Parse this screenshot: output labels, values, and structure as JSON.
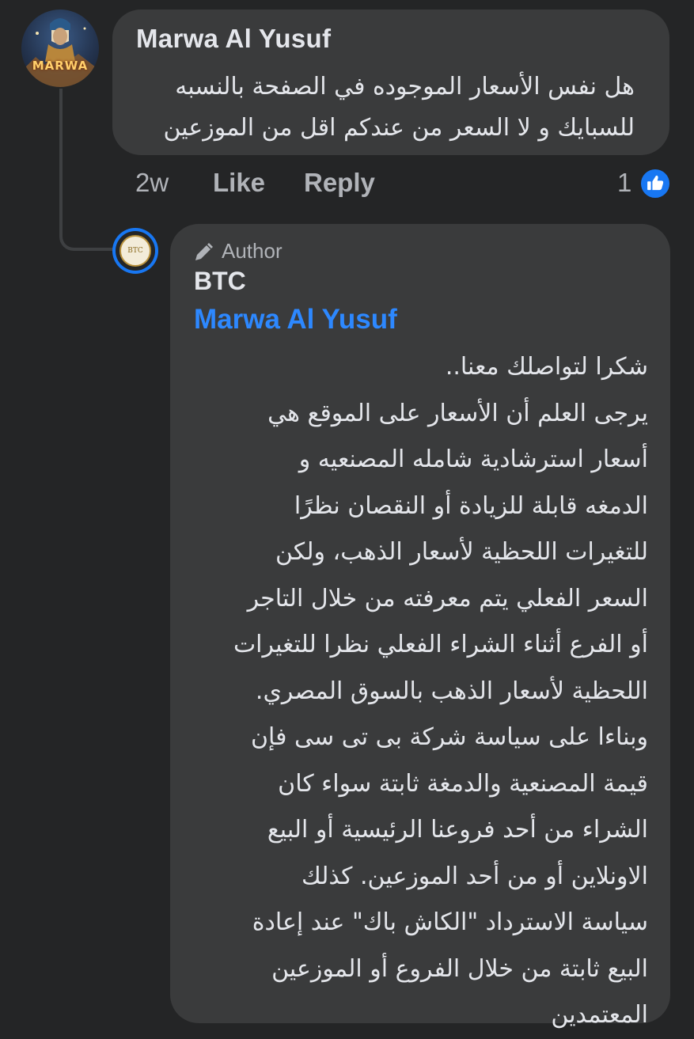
{
  "comment": {
    "author_name": "Marwa Al Yusuf",
    "avatar_text": "MARWA",
    "text_lines": [
      "هل نفس الأسعار الموجوده في الصفحة بالنسبه",
      "للسبايك و لا السعر من عندكم اقل من الموزعين"
    ],
    "time": "2w",
    "like_label": "Like",
    "reply_label": "Reply",
    "reaction_count": "1",
    "reaction_icon": "like-thumb-icon"
  },
  "reply": {
    "badge_label": "Author",
    "author_name": "BTC",
    "avatar_text": "BTC",
    "mention": "Marwa Al Yusuf",
    "text_lines": [
      "شكرا لتواصلك معنا..",
      "يرجى العلم أن الأسعار على الموقع هي",
      "أسعار استرشادية شامله المصنعيه و",
      "الدمغه قابلة للزيادة أو النقصان نظرًا",
      "للتغيرات اللحظية لأسعار الذهب، ولكن",
      "السعر الفعلي يتم معرفته من خلال التاجر",
      "أو الفرع أثناء الشراء الفعلي نظرا للتغيرات",
      "اللحظية لأسعار الذهب بالسوق المصري.",
      "وبناءا على سياسة شركة بى تى سى فإن",
      "قيمة المصنعية والدمغة ثابتة سواء كان",
      "الشراء من أحد فروعنا الرئيسية أو البيع",
      "الاونلاين أو من أحد الموزعين. كذلك",
      "سياسة الاسترداد \"الكاش باك\" عند إعادة",
      "البيع ثابتة من خلال الفروع أو الموزعين",
      "المعتمدين"
    ]
  },
  "colors": {
    "background": "#242526",
    "bubble": "#3a3b3c",
    "primary_text": "#e4e6eb",
    "secondary_text": "#b0b3b8",
    "link_blue": "#2d88ff",
    "like_blue": "#1877f2"
  }
}
